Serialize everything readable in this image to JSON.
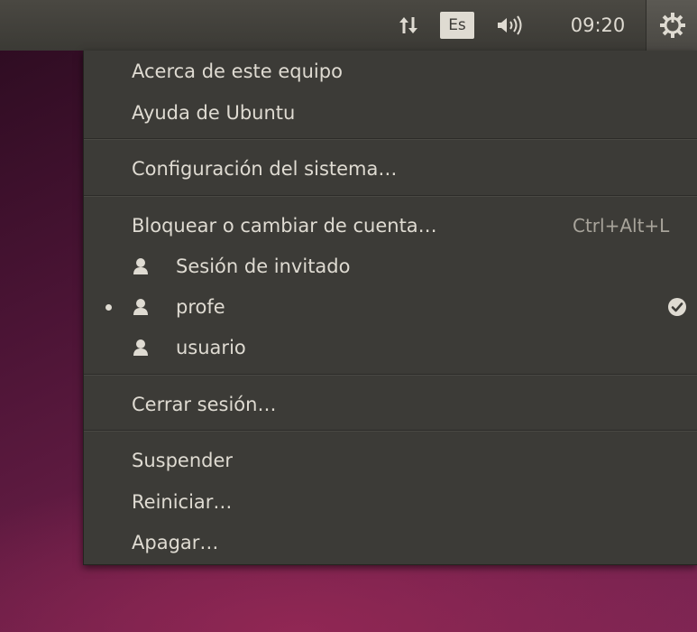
{
  "panel": {
    "indicators": {
      "network_icon": "network-updown-icon",
      "language_label": "Es",
      "sound_icon": "speaker-volume-icon",
      "clock": "09:20",
      "session_icon": "power-gear-icon"
    }
  },
  "menu": {
    "about": "Acerca de este equipo",
    "help": "Ayuda de Ubuntu",
    "settings": "Configuración del sistema…",
    "lock_switch": {
      "label": "Bloquear o cambiar de cuenta…",
      "shortcut": "Ctrl+Alt+L"
    },
    "users": [
      {
        "label": "Sesión de invitado",
        "active": false
      },
      {
        "label": "profe",
        "active": true
      },
      {
        "label": "usuario",
        "active": false
      }
    ],
    "logout": "Cerrar sesión…",
    "suspend": "Suspender",
    "restart": "Reiniciar…",
    "shutdown": "Apagar…"
  },
  "colors": {
    "panel_bg": "#3c3b37",
    "menu_bg": "#3c3b37",
    "menu_text": "#dfdbd2",
    "shortcut_text": "#a8a49b",
    "desktop_accent": "#6d1f49"
  }
}
